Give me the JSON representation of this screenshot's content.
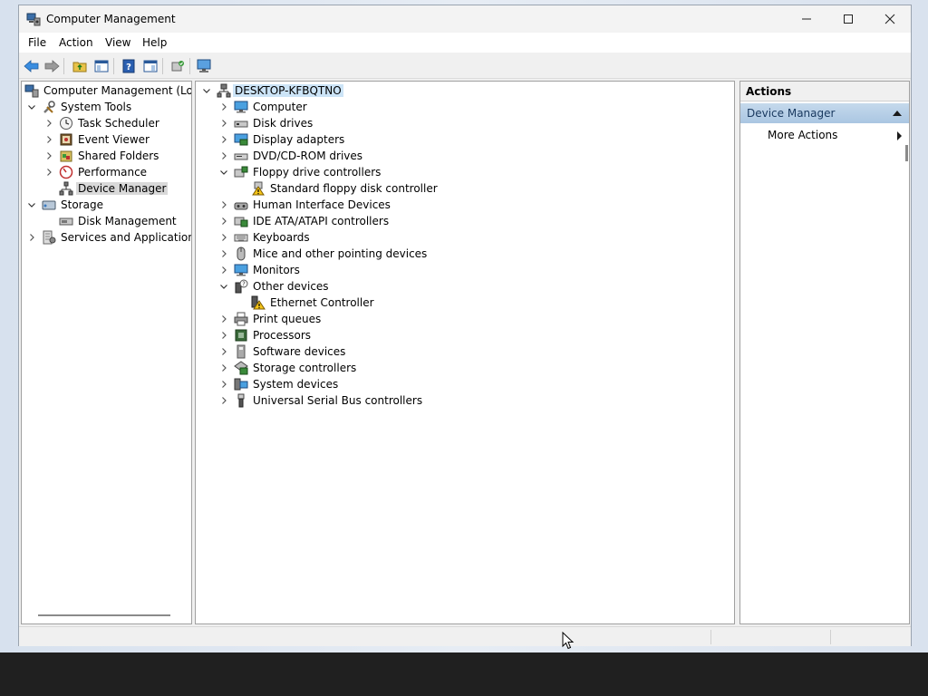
{
  "window": {
    "title": "Computer Management"
  },
  "menu": [
    "File",
    "Action",
    "View",
    "Help"
  ],
  "left_tree": [
    {
      "label": "Computer Management (Local",
      "icon": "computer-management-icon",
      "expander": "none"
    },
    {
      "label": "System Tools",
      "icon": "tools-icon",
      "expander": "expanded"
    },
    {
      "label": "Task Scheduler",
      "icon": "clock-icon",
      "expander": "collapsed"
    },
    {
      "label": "Event Viewer",
      "icon": "event-viewer-icon",
      "expander": "collapsed"
    },
    {
      "label": "Shared Folders",
      "icon": "shared-folder-icon",
      "expander": "collapsed"
    },
    {
      "label": "Performance",
      "icon": "performance-icon",
      "expander": "collapsed"
    },
    {
      "label": "Device Manager",
      "icon": "device-manager-icon",
      "expander": "none",
      "selected": true
    },
    {
      "label": "Storage",
      "icon": "storage-icon",
      "expander": "expanded"
    },
    {
      "label": "Disk Management",
      "icon": "disk-management-icon",
      "expander": "none"
    },
    {
      "label": "Services and Applications",
      "icon": "services-icon",
      "expander": "collapsed"
    }
  ],
  "device_tree": [
    {
      "label": "DESKTOP-KFBQTNO",
      "icon": "computer-root-icon",
      "expander": "expanded",
      "selected": true
    },
    {
      "label": "Computer",
      "icon": "monitor-icon",
      "expander": "collapsed"
    },
    {
      "label": "Disk drives",
      "icon": "disk-drive-icon",
      "expander": "collapsed"
    },
    {
      "label": "Display adapters",
      "icon": "display-adapter-icon",
      "expander": "collapsed"
    },
    {
      "label": "DVD/CD-ROM drives",
      "icon": "dvd-drive-icon",
      "expander": "collapsed"
    },
    {
      "label": "Floppy drive controllers",
      "icon": "floppy-controller-icon",
      "expander": "expanded"
    },
    {
      "label": "Standard floppy disk controller",
      "icon": "warning-device-icon",
      "expander": "none"
    },
    {
      "label": "Human Interface Devices",
      "icon": "hid-icon",
      "expander": "collapsed"
    },
    {
      "label": "IDE ATA/ATAPI controllers",
      "icon": "ide-controller-icon",
      "expander": "collapsed"
    },
    {
      "label": "Keyboards",
      "icon": "keyboard-icon",
      "expander": "collapsed"
    },
    {
      "label": "Mice and other pointing devices",
      "icon": "mouse-icon",
      "expander": "collapsed"
    },
    {
      "label": "Monitors",
      "icon": "monitor-icon",
      "expander": "collapsed"
    },
    {
      "label": "Other devices",
      "icon": "unknown-device-icon",
      "expander": "expanded"
    },
    {
      "label": "Ethernet Controller",
      "icon": "warning-device-icon",
      "expander": "none"
    },
    {
      "label": "Print queues",
      "icon": "printer-icon",
      "expander": "collapsed"
    },
    {
      "label": "Processors",
      "icon": "processor-icon",
      "expander": "collapsed"
    },
    {
      "label": "Software devices",
      "icon": "software-device-icon",
      "expander": "collapsed"
    },
    {
      "label": "Storage controllers",
      "icon": "storage-controller-icon",
      "expander": "collapsed"
    },
    {
      "label": "System devices",
      "icon": "system-devices-icon",
      "expander": "collapsed"
    },
    {
      "label": "Universal Serial Bus controllers",
      "icon": "usb-icon",
      "expander": "collapsed"
    }
  ],
  "actions": {
    "header": "Actions",
    "section": "Device Manager",
    "more": "More Actions"
  },
  "colors": {
    "selection_blue": "#cce4f7",
    "selection_grey": "#d9d9d9",
    "actions_section": "#b8d0e8",
    "taskbar": "#202020"
  }
}
